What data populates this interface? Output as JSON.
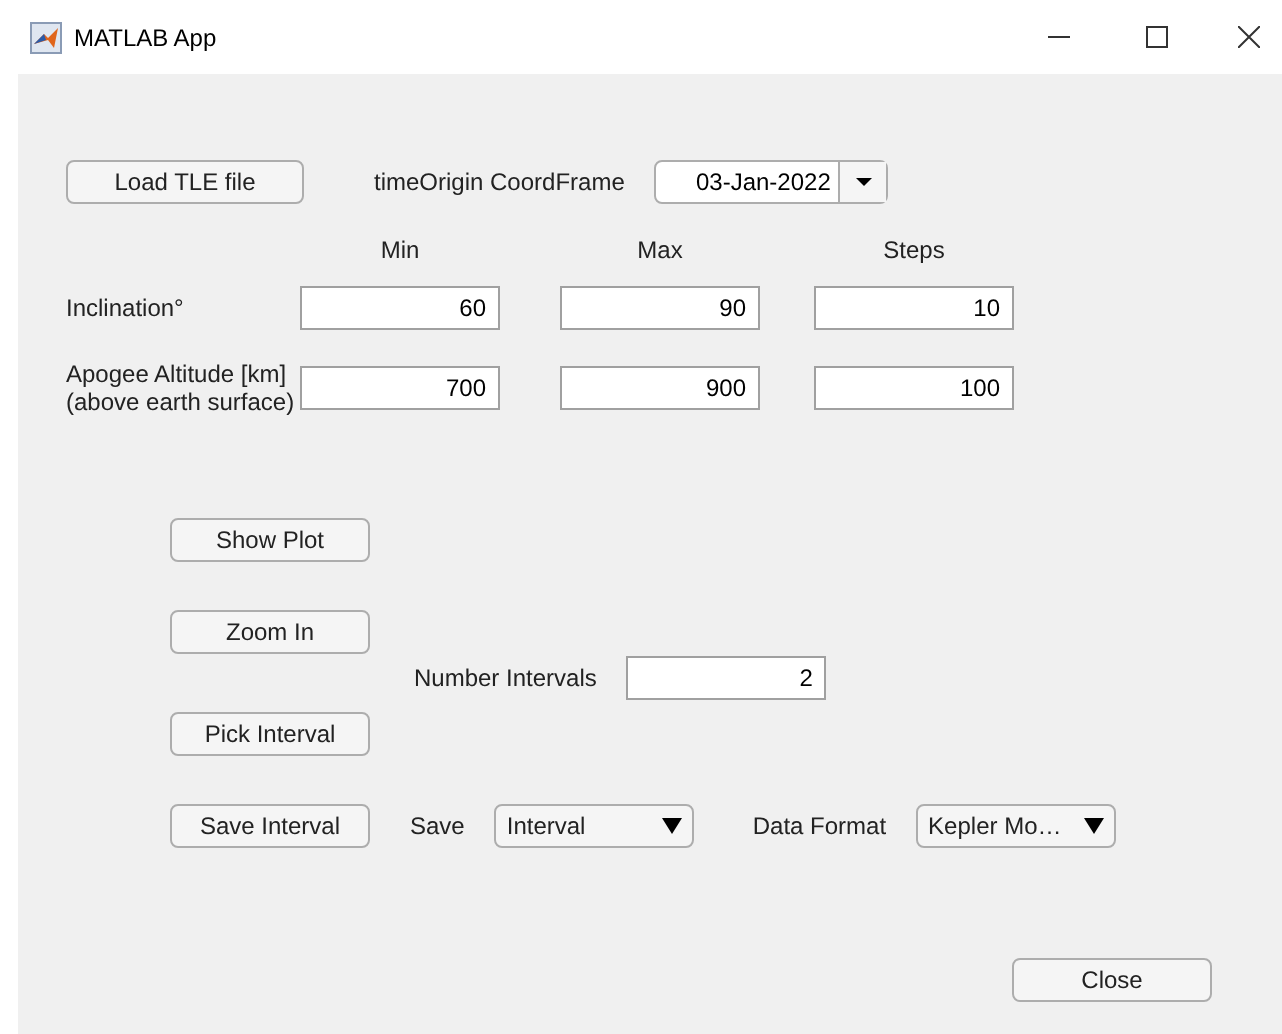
{
  "window": {
    "title": "MATLAB App"
  },
  "load_button": "Load TLE file",
  "time_origin": {
    "label": "timeOrigin CoordFrame",
    "value": "03-Jan-2022"
  },
  "range_table": {
    "columns": [
      "Min",
      "Max",
      "Steps"
    ],
    "rows": [
      {
        "label": "Inclination°",
        "values": [
          "60",
          "90",
          "10"
        ]
      },
      {
        "label": "Apogee Altitude [km]\n(above earth surface)",
        "values": [
          "700",
          "900",
          "100"
        ]
      }
    ]
  },
  "show_plot_button": "Show Plot",
  "zoom_in_button": "Zoom In",
  "number_intervals": {
    "label": "Number Intervals",
    "value": "2"
  },
  "pick_interval_button": "Pick Interval",
  "save_interval_button": "Save Interval",
  "save": {
    "label": "Save",
    "value": "Interval"
  },
  "data_format": {
    "label": "Data Format",
    "value": "Kepler Mo…"
  },
  "close_button": "Close"
}
